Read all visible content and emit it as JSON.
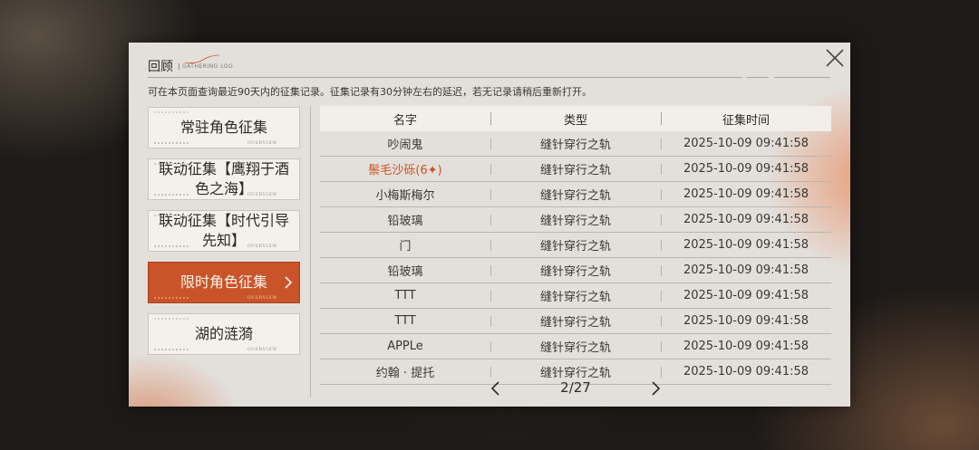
{
  "dialog": {
    "title": "回顾",
    "title_sub": "GATHERING LOG",
    "notice": "可在本页面查询最近90天内的征集记录。征集记录有30分钟左右的延迟，若无记录请稍后重新打开。"
  },
  "categories": [
    {
      "label": "常驻角色征集",
      "overview": "OVERVIEW",
      "active": false
    },
    {
      "label": "联动征集【鹰翔于酒色之海】",
      "overview": "OVERVIEW",
      "active": false
    },
    {
      "label": "联动征集【时代引导先知】",
      "overview": "OVERVIEW",
      "active": false
    },
    {
      "label": "限时角色征集",
      "overview": "OVERVIEW",
      "active": true
    },
    {
      "label": "湖的涟漪",
      "overview": "OVERVIEW",
      "active": false
    }
  ],
  "table": {
    "headers": [
      "名字",
      "类型",
      "征集时间"
    ],
    "rows": [
      {
        "name": "吵闹鬼",
        "type": "缝针穿行之轨",
        "time": "2025-10-09 09:41:58",
        "special": false
      },
      {
        "name": "鬃毛沙砾(6✦)",
        "type": "缝针穿行之轨",
        "time": "2025-10-09 09:41:58",
        "special": true
      },
      {
        "name": "小梅斯梅尔",
        "type": "缝针穿行之轨",
        "time": "2025-10-09 09:41:58",
        "special": false
      },
      {
        "name": "铅玻璃",
        "type": "缝针穿行之轨",
        "time": "2025-10-09 09:41:58",
        "special": false
      },
      {
        "name": "门",
        "type": "缝针穿行之轨",
        "time": "2025-10-09 09:41:58",
        "special": false
      },
      {
        "name": "铅玻璃",
        "type": "缝针穿行之轨",
        "time": "2025-10-09 09:41:58",
        "special": false
      },
      {
        "name": "TTT",
        "type": "缝针穿行之轨",
        "time": "2025-10-09 09:41:58",
        "special": false
      },
      {
        "name": "TTT",
        "type": "缝针穿行之轨",
        "time": "2025-10-09 09:41:58",
        "special": false
      },
      {
        "name": "APPLe",
        "type": "缝针穿行之轨",
        "time": "2025-10-09 09:41:58",
        "special": false
      },
      {
        "name": "约翰 · 提托",
        "type": "缝针穿行之轨",
        "time": "2025-10-09 09:41:58",
        "special": false
      }
    ]
  },
  "pagination": {
    "text": "2/27"
  },
  "colors": {
    "accent": "#c9542a",
    "special_name": "#c9541f"
  },
  "icons": {
    "close": "close-icon",
    "prev": "chevron-left-icon",
    "next": "chevron-right-icon",
    "category_arrow": "chevron-right-icon"
  }
}
